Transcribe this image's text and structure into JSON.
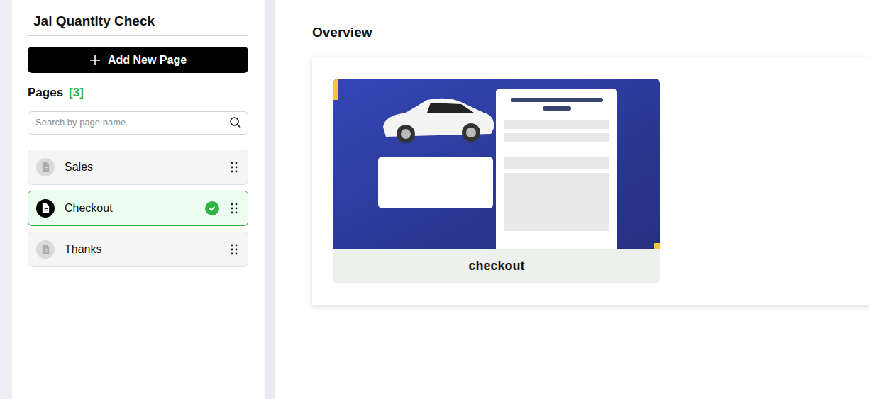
{
  "project": {
    "title": "Jai Quantity Check"
  },
  "add_button": {
    "label": "Add New Page"
  },
  "pages": {
    "label": "Pages",
    "count": "[3]"
  },
  "search": {
    "placeholder": "Search by page name"
  },
  "page_list": [
    {
      "label": "Sales",
      "selected": false
    },
    {
      "label": "Checkout",
      "selected": true
    },
    {
      "label": "Thanks",
      "selected": false
    }
  ],
  "overview": {
    "title": "Overview",
    "cards": [
      {
        "label": "checkout"
      }
    ]
  }
}
